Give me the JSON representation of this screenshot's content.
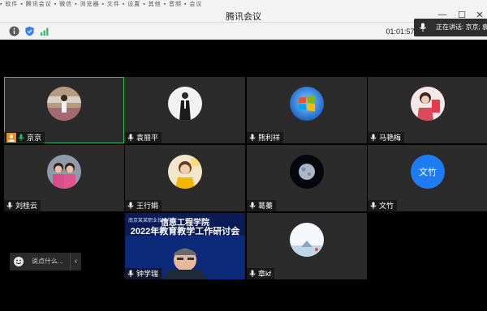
{
  "window": {
    "title": "腾讯会议",
    "taskbar_strip": "▪ 软件 ▪ 腾讯会议 ▪ 微信 ▪ 浏览器 ▪ 文件 ▪ 设置 ▪ 其他 ▪ 音频 ▪ 会议",
    "minimize_glyph": "—",
    "maximize_glyph": "☐",
    "close_glyph": "✕"
  },
  "status": {
    "timer": "01:01:57"
  },
  "speaking": {
    "text": "正在讲话: 京京; 袁"
  },
  "participants": [
    {
      "name": "京京",
      "avatar": "photo",
      "is_host": true,
      "active": true
    },
    {
      "name": "袁丽平",
      "avatar": "photo"
    },
    {
      "name": "熊利祥",
      "avatar": "windows-logo"
    },
    {
      "name": "马艳梅",
      "avatar": "photo"
    },
    {
      "name": "刘桂云",
      "avatar": "photo"
    },
    {
      "name": "王行娟",
      "avatar": "photo"
    },
    {
      "name": "葛蓁",
      "avatar": "moon"
    },
    {
      "name": "文竹",
      "avatar": "initials",
      "initials": "文竹",
      "avatar_color": "#1e7cf2"
    },
    {
      "name": "钟学瑞",
      "avatar": "screen-share"
    },
    {
      "name": "章kf",
      "avatar": "photo"
    }
  ],
  "screen_share": {
    "univ_text": "南京某某职业技术学院",
    "line1": "信息工程学院",
    "line2": "2022年教育教学工作研讨会"
  },
  "chat": {
    "placeholder": "说点什么...",
    "collapse_glyph": "‹"
  },
  "colors": {
    "active_border": "#29c36a",
    "host_badge": "#f08a24",
    "initials_avatar": "#1e7cf2"
  }
}
